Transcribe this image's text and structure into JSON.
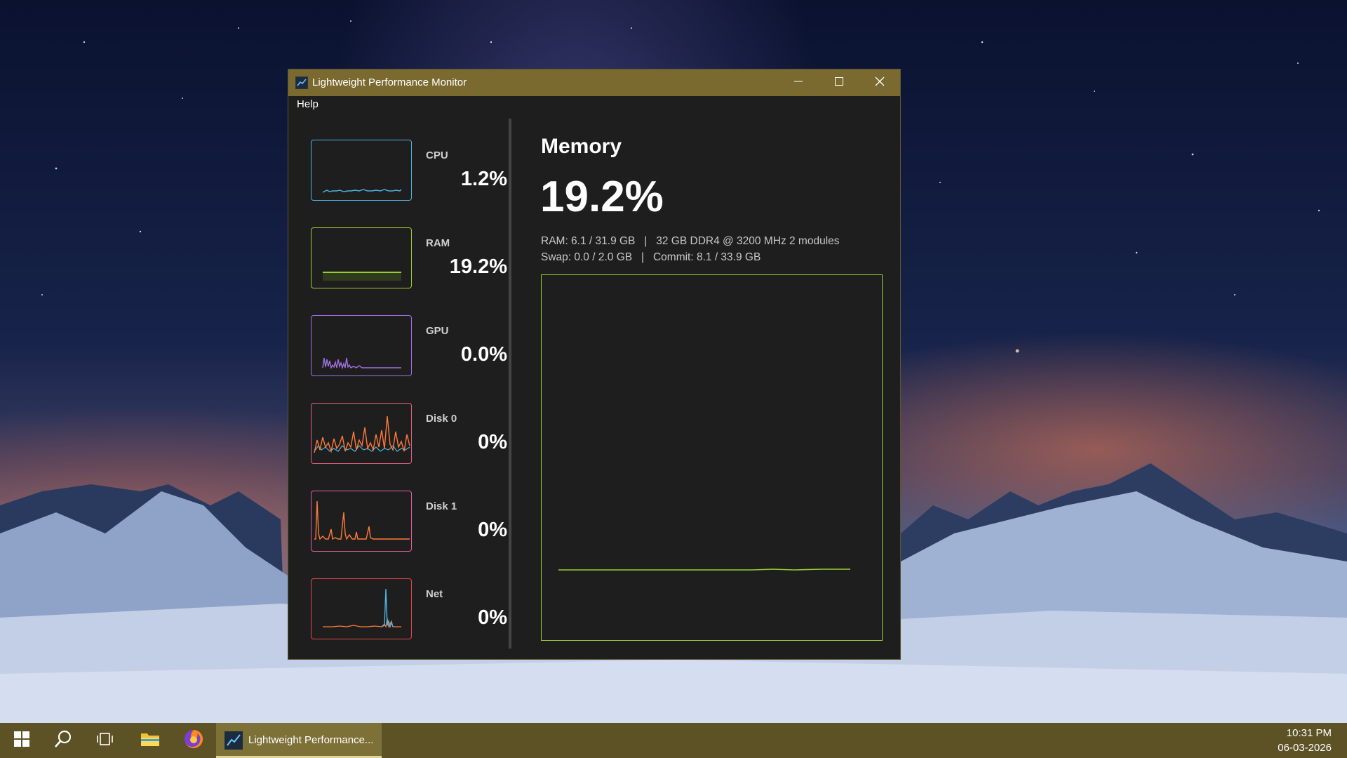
{
  "window": {
    "title": "Lightweight Performance Monitor",
    "minimize_icon": "minimize-icon",
    "maximize_icon": "maximize-icon",
    "close_icon": "close-icon"
  },
  "menu": {
    "help": "Help"
  },
  "sidebar": {
    "items": [
      {
        "label": "CPU",
        "value": "1.2%",
        "color": "#4fb4e0"
      },
      {
        "label": "RAM",
        "value": "19.2%",
        "color": "#9acd32"
      },
      {
        "label": "GPU",
        "value": "0.0%",
        "color": "#a070e0"
      },
      {
        "label": "Disk 0",
        "value": "0%",
        "color": "#e06080",
        "series_colors": [
          "#ff7a3a",
          "#4fb4e0"
        ]
      },
      {
        "label": "Disk 1",
        "value": "0%",
        "color": "#e060a0",
        "series_colors": [
          "#ff7a3a"
        ]
      },
      {
        "label": "Net",
        "value": "0%",
        "color": "#e04848",
        "series_colors": [
          "#ff7a3a",
          "#4fb4e0"
        ]
      }
    ]
  },
  "main": {
    "title": "Memory",
    "value": "19.2%",
    "details": [
      "RAM: 6.1 / 31.9 GB   |   32 GB DDR4 @ 3200 MHz 2 modules",
      "Swap: 0.0 / 2.0 GB   |   Commit: 8.1 / 33.9 GB"
    ],
    "graph_color": "#9acd32"
  },
  "taskbar": {
    "start_icon": "windows-start-icon",
    "search_icon": "search-icon",
    "taskview_icon": "task-view-icon",
    "explorer_icon": "file-explorer-icon",
    "firefox_icon": "firefox-icon",
    "active_app_label": "Lightweight Performance...",
    "time": "10:31 PM",
    "date": "06-03-2026",
    "color": "#5c5226"
  }
}
